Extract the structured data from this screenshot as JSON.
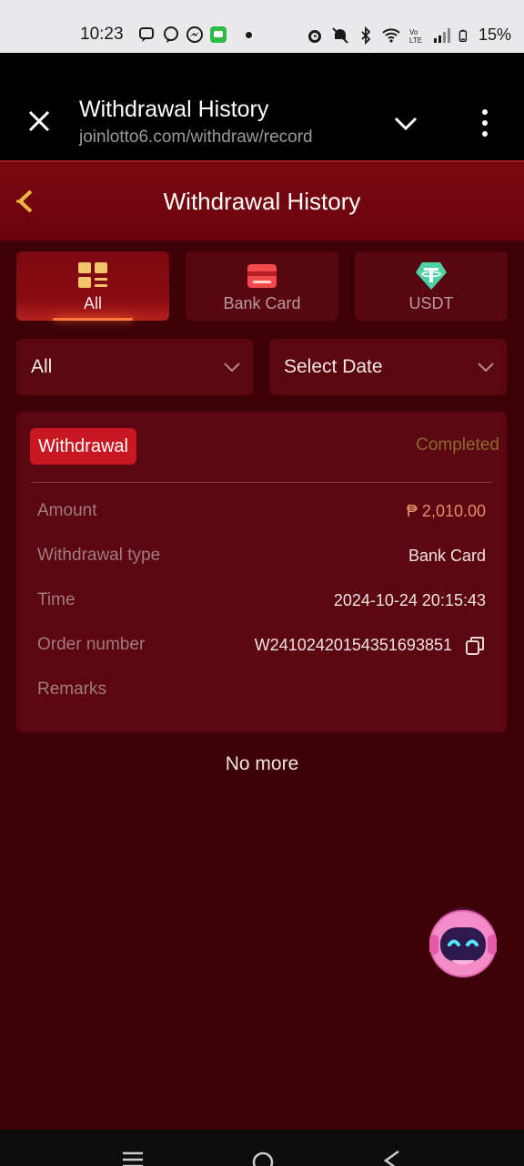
{
  "status_bar": {
    "time": "10:23",
    "battery": "15%",
    "icons": [
      "message-icon",
      "viber-icon",
      "messenger-icon",
      "chat-app-icon",
      "alarm-icon",
      "mute-icon",
      "bluetooth-icon",
      "wifi-icon",
      "volte-icon",
      "signal-icon",
      "battery-icon"
    ]
  },
  "browser": {
    "title": "Withdrawal History",
    "url": "joinlotto6.com/withdraw/record"
  },
  "header": {
    "title": "Withdrawal History"
  },
  "tabs": [
    {
      "label": "All",
      "active": true,
      "icon": "grid-icon"
    },
    {
      "label": "Bank Card",
      "active": false,
      "icon": "card-icon"
    },
    {
      "label": "USDT",
      "active": false,
      "icon": "tether-icon"
    }
  ],
  "filters": {
    "type": "All",
    "date": "Select Date"
  },
  "record": {
    "badge": "Withdrawal",
    "status": "Completed",
    "rows": [
      {
        "label": "Amount",
        "value": "₱ 2,010.00"
      },
      {
        "label": "Withdrawal type",
        "value": "Bank Card"
      },
      {
        "label": "Time",
        "value": "2024-10-24 20:15:43"
      },
      {
        "label": "Order number",
        "value": "W241024201543516938​51"
      },
      {
        "label": "Remarks",
        "value": ""
      }
    ]
  },
  "footer_text": "No more",
  "colors": {
    "background": "#3d0007",
    "header": "#6a050d",
    "card": "#5b0610",
    "badge": "#c81720",
    "status_completed": "#8a6c2d",
    "amount": "#e88f6a"
  }
}
